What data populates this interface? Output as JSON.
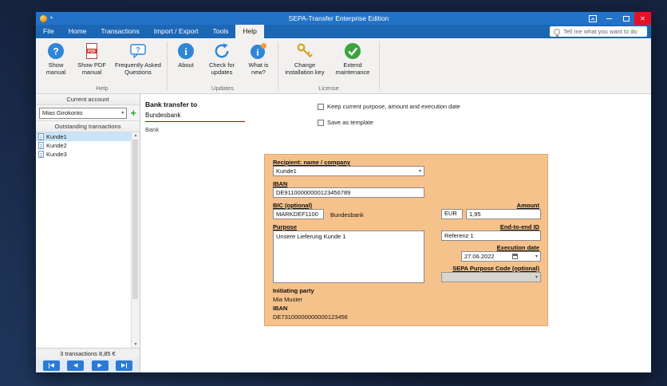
{
  "window": {
    "title": "SEPA-Transfer Enterprise Edition",
    "search_hint": "Tell me what you want to do"
  },
  "menu": {
    "tabs": [
      {
        "label": "File"
      },
      {
        "label": "Home"
      },
      {
        "label": "Transactions"
      },
      {
        "label": "Import / Export"
      },
      {
        "label": "Tools"
      },
      {
        "label": "Help",
        "active": true
      }
    ]
  },
  "ribbon": {
    "groups": [
      {
        "label": "Help",
        "buttons": [
          {
            "label": "Show manual",
            "icon": "question-circle-icon"
          },
          {
            "label": "Show PDF manual",
            "icon": "pdf-icon"
          },
          {
            "label": "Frequently Asked Questions",
            "icon": "faq-bubble-icon"
          }
        ]
      },
      {
        "label": "Updates",
        "buttons": [
          {
            "label": "About",
            "icon": "info-circle-icon"
          },
          {
            "label": "Check for updates",
            "icon": "refresh-icon"
          },
          {
            "label": "What is new?",
            "icon": "whats-new-icon"
          }
        ]
      },
      {
        "label": "License",
        "buttons": [
          {
            "label": "Change installation key",
            "icon": "key-icon"
          },
          {
            "label": "Extend maintenance",
            "icon": "check-circle-icon"
          }
        ]
      }
    ]
  },
  "sidebar": {
    "current_account_header": "Current account",
    "account_name": "Mias Girokonto",
    "outstanding_header": "Outstanding transactions",
    "transactions": [
      {
        "label": "Kunde1",
        "selected": true
      },
      {
        "label": "Kunde2",
        "selected": false
      },
      {
        "label": "Kunde3",
        "selected": false
      }
    ],
    "summary": "3 transactions 8,85 €"
  },
  "content": {
    "title": "Bank transfer to",
    "bank_value": "Bundesbank",
    "bank_caption": "Bank",
    "checkboxes": [
      {
        "label": "Keep current purpose, amount and execution date",
        "checked": false
      },
      {
        "label": "Save as template",
        "checked": false
      }
    ]
  },
  "form": {
    "recipient_label": "Recipient: name / company",
    "recipient_value": "Kunde1",
    "iban_label": "IBAN",
    "iban_value": "DE91100000000123456789",
    "bic_label": "BIC (optional)",
    "bic_value": "MARKDEF1100",
    "bic_bank_name": "Bundesbank",
    "amount_label": "Amount",
    "currency_code": "EUR",
    "amount_value": "1,95",
    "purpose_label": "Purpose",
    "purpose_value": "Unsere Lieferung Kunde 1",
    "e2e_label": "End-to-end ID",
    "e2e_value": "Referenz 1",
    "execution_date_label": "Execution date",
    "execution_date_value": "27.06.2022",
    "sepa_code_label": "SEPA Purpose Code (optional)",
    "sepa_code_value": "",
    "initiating_party_label": "Initiating party",
    "initiating_party_name": "Mia Muster",
    "initiating_iban_label": "IBAN",
    "initiating_iban_value": "DE73100000000000123456"
  },
  "colors": {
    "desktop": "#16233f",
    "titlebar": "#2273c8",
    "menubar": "#1d66b4",
    "ribbon-bg": "#f2f1f0",
    "close-red": "#e81123",
    "panel-orange": "#f6c28c",
    "accent-blue": "#2b7bd4",
    "selection-blue": "#c8e4f8",
    "error-red": "#c00000",
    "plus-green": "#31a83a"
  }
}
